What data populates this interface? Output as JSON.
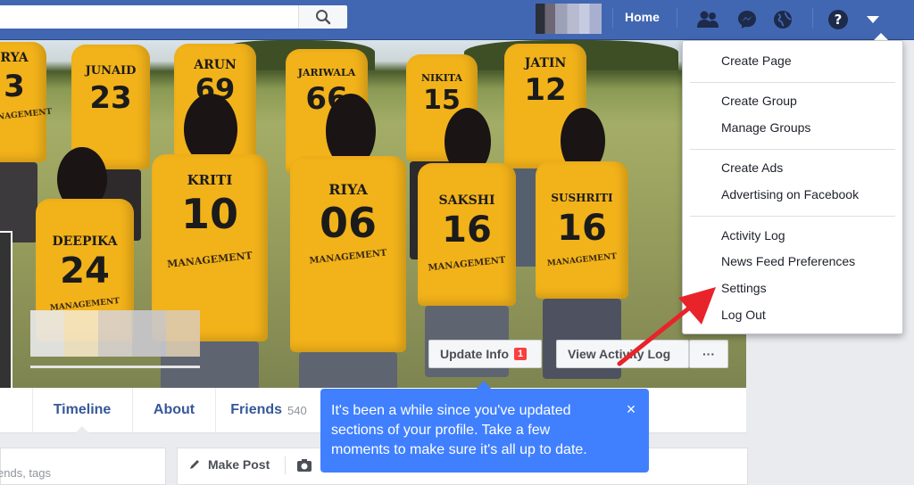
{
  "topbar": {
    "search_placeholder": "",
    "home_label": "Home",
    "icons": [
      "search-icon",
      "friend-requests-icon",
      "messenger-icon",
      "globe-icon",
      "help-icon",
      "caret-down-icon"
    ]
  },
  "cover": {
    "players": [
      {
        "name": "JUNAID",
        "number": "23"
      },
      {
        "name": "ARUN",
        "number": "69"
      },
      {
        "name": "JARIWALA",
        "number": "66"
      },
      {
        "name": "NIKITA",
        "number": "15"
      },
      {
        "name": "JATIN",
        "number": "12"
      },
      {
        "name": "DEEPIKA",
        "number": "24",
        "text": "MANAGEMENT"
      },
      {
        "name": "KRITI",
        "number": "10",
        "text": "MANAGEMENT"
      },
      {
        "name": "RIYA",
        "number": "06",
        "text": "MANAGEMENT"
      },
      {
        "name": "SAKSHI",
        "number": "16",
        "text": "MANAGEMENT"
      },
      {
        "name": "SUSHRITI",
        "number": "16",
        "text": "MANAGEMENT"
      },
      {
        "name": "RYA",
        "number": "3",
        "text": "MANAGEMENT"
      }
    ],
    "update_info_label": "Update Info",
    "update_info_badge": "1",
    "view_activity_label": "View Activity Log",
    "more_label": "···"
  },
  "tabs": [
    {
      "label": "Timeline"
    },
    {
      "label": "About"
    },
    {
      "label": "Friends",
      "count": "540"
    }
  ],
  "left_card": {
    "text": "ends, tags"
  },
  "post_card": {
    "make_post_label": "Make Post"
  },
  "tooltip": {
    "text": "It's been a while since you've updated sections of your profile. Take a few moments to make sure it's all up to date.",
    "close": "×"
  },
  "menu": {
    "items": [
      "Create Page",
      "Create Group",
      "Manage Groups",
      "Create Ads",
      "Advertising on Facebook",
      "Activity Log",
      "News Feed Preferences",
      "Settings",
      "Log Out"
    ]
  },
  "colors": {
    "brand": "#4267b2",
    "tooltip": "#4080ff",
    "annotation_arrow": "#e8232a"
  }
}
